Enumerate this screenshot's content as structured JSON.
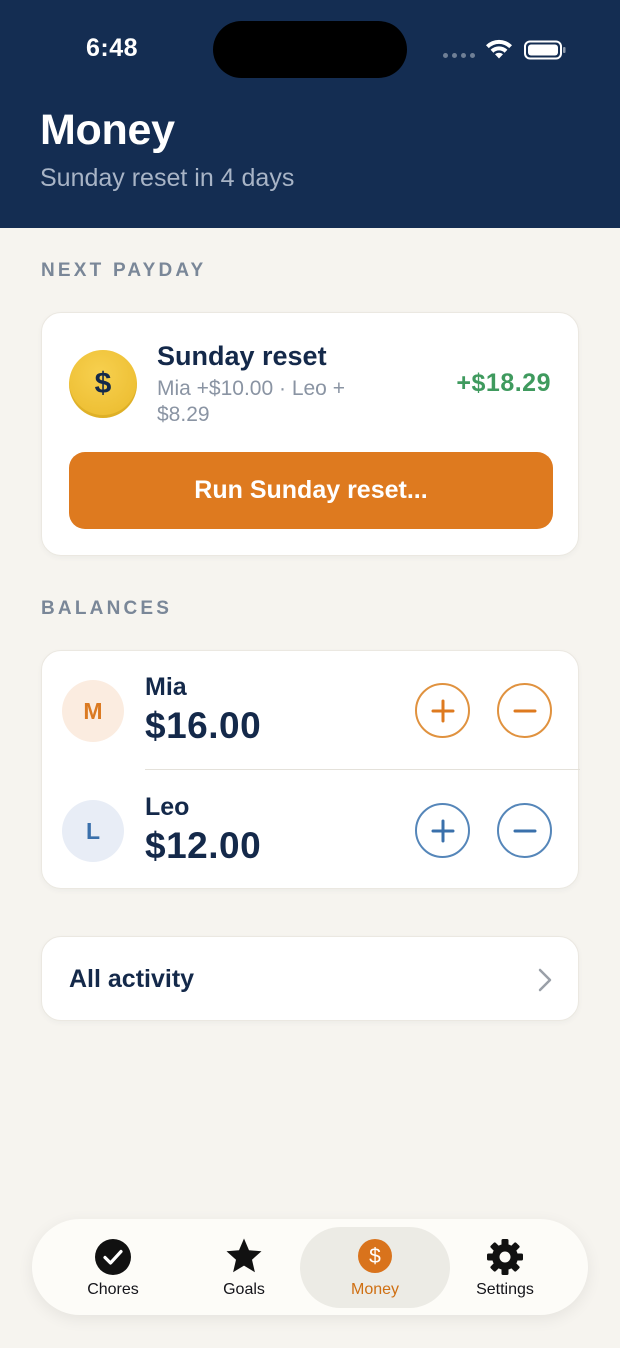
{
  "status_bar": {
    "time": "6:48"
  },
  "header": {
    "title": "Money",
    "subtitle": "Sunday reset in 4 days"
  },
  "next_payday": {
    "section_label": "NEXT PAYDAY",
    "coin_symbol": "$",
    "title": "Sunday reset",
    "detail": "Mia +$10.00 · Leo + $8.29",
    "amount": "+$18.29",
    "button_label": "Run Sunday reset..."
  },
  "balances": {
    "section_label": "BALANCES",
    "items": [
      {
        "initial": "M",
        "name": "Mia",
        "amount": "$16.00",
        "accent": "#e0923f"
      },
      {
        "initial": "L",
        "name": "Leo",
        "amount": "$12.00",
        "accent": "#5586b9"
      }
    ]
  },
  "activity": {
    "label": "All activity"
  },
  "tabbar": {
    "active": "Money",
    "tabs": [
      {
        "label": "Chores",
        "icon": "check-circle-icon"
      },
      {
        "label": "Goals",
        "icon": "star-icon"
      },
      {
        "label": "Money",
        "icon": "dollar-circle-icon"
      },
      {
        "label": "Settings",
        "icon": "gear-icon"
      }
    ]
  },
  "colors": {
    "header": "#142d52",
    "accent": "#de7a1f",
    "positive": "#3f9a5e"
  }
}
